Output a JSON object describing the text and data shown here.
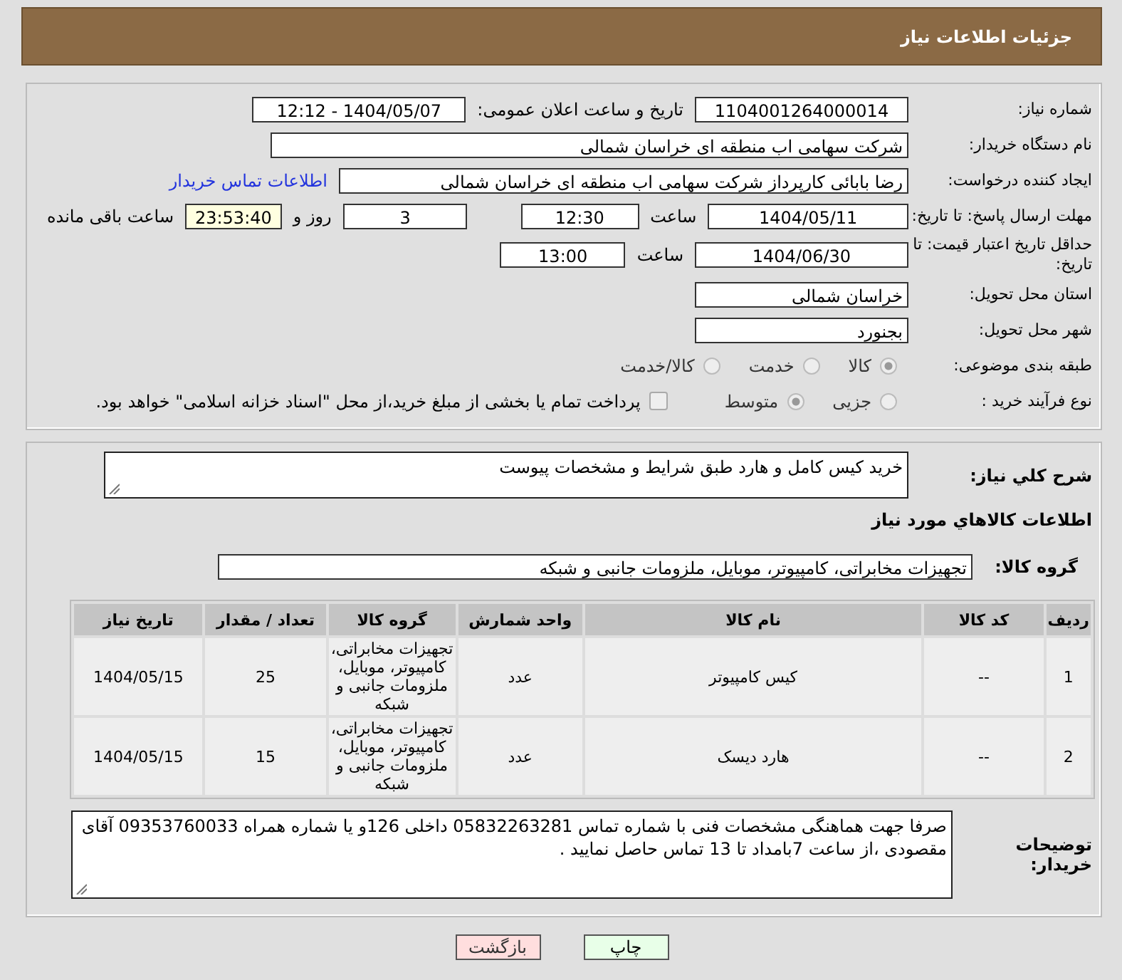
{
  "header": {
    "title": "جزئیات اطلاعات نیاز"
  },
  "need_number": {
    "label": "شماره نیاز:",
    "value": "1104001264000014"
  },
  "announce": {
    "label": "تاریخ و ساعت اعلان عمومی:",
    "value": "1404/05/07 - 12:12"
  },
  "buyer": {
    "label": "نام دستگاه خریدار:",
    "value": "شرکت سهامی اب منطقه ای خراسان شمالی"
  },
  "requester": {
    "label": "ایجاد کننده درخواست:",
    "value": "رضا بابائی کارپرداز شرکت سهامی اب منطقه ای خراسان شمالی",
    "link": "اطلاعات تماس خریدار"
  },
  "deadline": {
    "label": "مهلت ارسال پاسخ: تا تاریخ:",
    "date": "1404/05/11",
    "time_label": "ساعت",
    "time": "12:30",
    "days": "3",
    "days_label": "روز و",
    "remaining": "23:53:40",
    "remaining_label": "ساعت باقی مانده"
  },
  "validity": {
    "label": "حداقل تاریخ اعتبار قیمت: تا تاریخ:",
    "date": "1404/06/30",
    "time_label": "ساعت",
    "time": "13:00"
  },
  "province": {
    "label": "استان محل تحویل:",
    "value": "خراسان شمالی"
  },
  "city": {
    "label": "شهر محل تحویل:",
    "value": "بجنورد"
  },
  "category": {
    "label": "طبقه بندی موضوعی:",
    "options": [
      {
        "label": "کالا",
        "selected": true
      },
      {
        "label": "خدمت",
        "selected": false
      },
      {
        "label": "کالا/خدمت",
        "selected": false
      }
    ]
  },
  "process": {
    "label": "نوع فرآیند خرید :",
    "options": [
      {
        "label": "جزیی",
        "selected": false
      },
      {
        "label": "متوسط",
        "selected": true
      }
    ],
    "payment": {
      "label": "پرداخت تمام یا بخشی از مبلغ خرید،از محل \"اسناد خزانه اسلامی\" خواهد بود.",
      "checked": false
    }
  },
  "description": {
    "label": "شرح كلي نياز:",
    "value": "خرید کیس کامل و هارد طبق شرایط و مشخصات پیوست"
  },
  "goods_title": "اطلاعات كالاهاي مورد نياز",
  "goods_group": {
    "label": "گروه کالا:",
    "value": "تجهیزات مخابراتی، کامپیوتر، موبایل، ملزومات جانبی و شبکه"
  },
  "table": {
    "columns": [
      "ردیف",
      "کد کالا",
      "نام کالا",
      "واحد شمارش",
      "گروه کالا",
      "تعداد / مقدار",
      "تاریخ نیاز"
    ],
    "rows": [
      [
        "1",
        "--",
        "کیس کامپیوتر",
        "عدد",
        "تجهیزات مخابراتی، کامپیوتر، موبایل، ملزومات جانبی و شبکه",
        "25",
        "1404/05/15"
      ],
      [
        "2",
        "--",
        "هارد دیسک",
        "عدد",
        "تجهیزات مخابراتی، کامپیوتر، موبایل، ملزومات جانبی و شبکه",
        "15",
        "1404/05/15"
      ]
    ]
  },
  "notes": {
    "label": "توضیحات خریدار:",
    "value": "صرفا جهت هماهنگی مشخصات فنی با شماره تماس 05832263281 داخلی 126و یا شماره همراه 09353760033 آقای مقصودی ،از ساعت 7بامداد تا 13 تماس حاصل نمایید ."
  },
  "buttons": [
    {
      "label": "چاپ",
      "kind": "print"
    },
    {
      "label": "بازگشت",
      "kind": "back"
    }
  ]
}
